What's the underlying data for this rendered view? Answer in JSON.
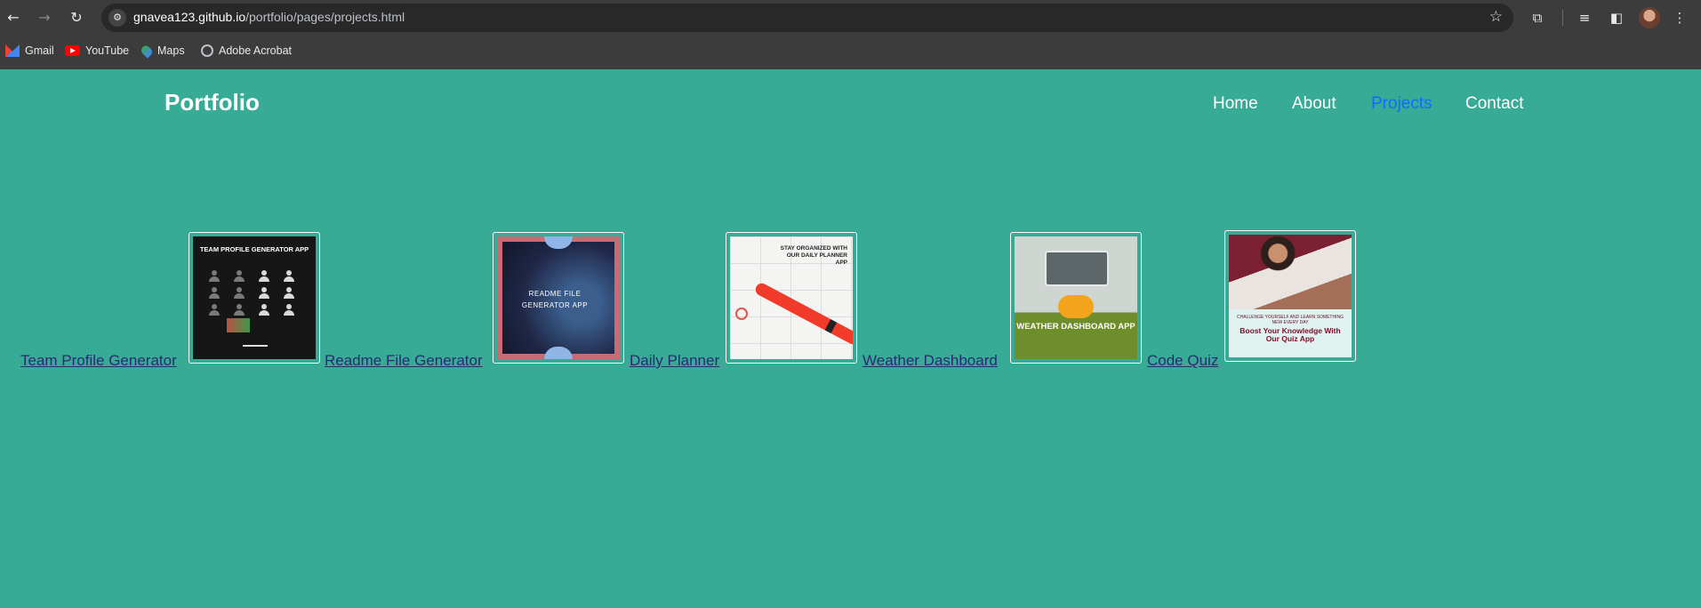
{
  "browser": {
    "url_host": "gnavea123.github.io",
    "url_path": "/portfolio/pages/projects.html",
    "bookmarks": [
      {
        "label": "Gmail",
        "icon": "gmail-icon"
      },
      {
        "label": "YouTube",
        "icon": "youtube-icon"
      },
      {
        "label": "Maps",
        "icon": "maps-icon"
      },
      {
        "label": "Adobe Acrobat",
        "icon": "globe-icon"
      }
    ]
  },
  "site": {
    "brand": "Portfolio",
    "nav": [
      {
        "label": "Home",
        "active": false
      },
      {
        "label": "About",
        "active": false
      },
      {
        "label": "Projects",
        "active": true
      },
      {
        "label": "Contact",
        "active": false
      }
    ],
    "active_nav_color": "#0d6efd",
    "background_color": "#38ab97"
  },
  "projects": [
    {
      "label": "Team Profile Generator",
      "thumb_text": "TEAM PROFILE GENERATOR APP"
    },
    {
      "label": "Readme File Generator",
      "thumb_text": "README FILE GENERATOR APP"
    },
    {
      "label": "Daily Planner",
      "thumb_text": "STAY ORGANIZED WITH OUR DAILY PLANNER APP"
    },
    {
      "label": "Weather Dashboard",
      "thumb_text": "WEATHER DASHBOARD APP"
    },
    {
      "label": "Code Quiz",
      "thumb_text": "Boost Your Knowledge With Our Quiz App",
      "thumb_subtext": "CHALLENGE YOURSELF AND LEARN SOMETHING NEW EVERY DAY"
    }
  ]
}
